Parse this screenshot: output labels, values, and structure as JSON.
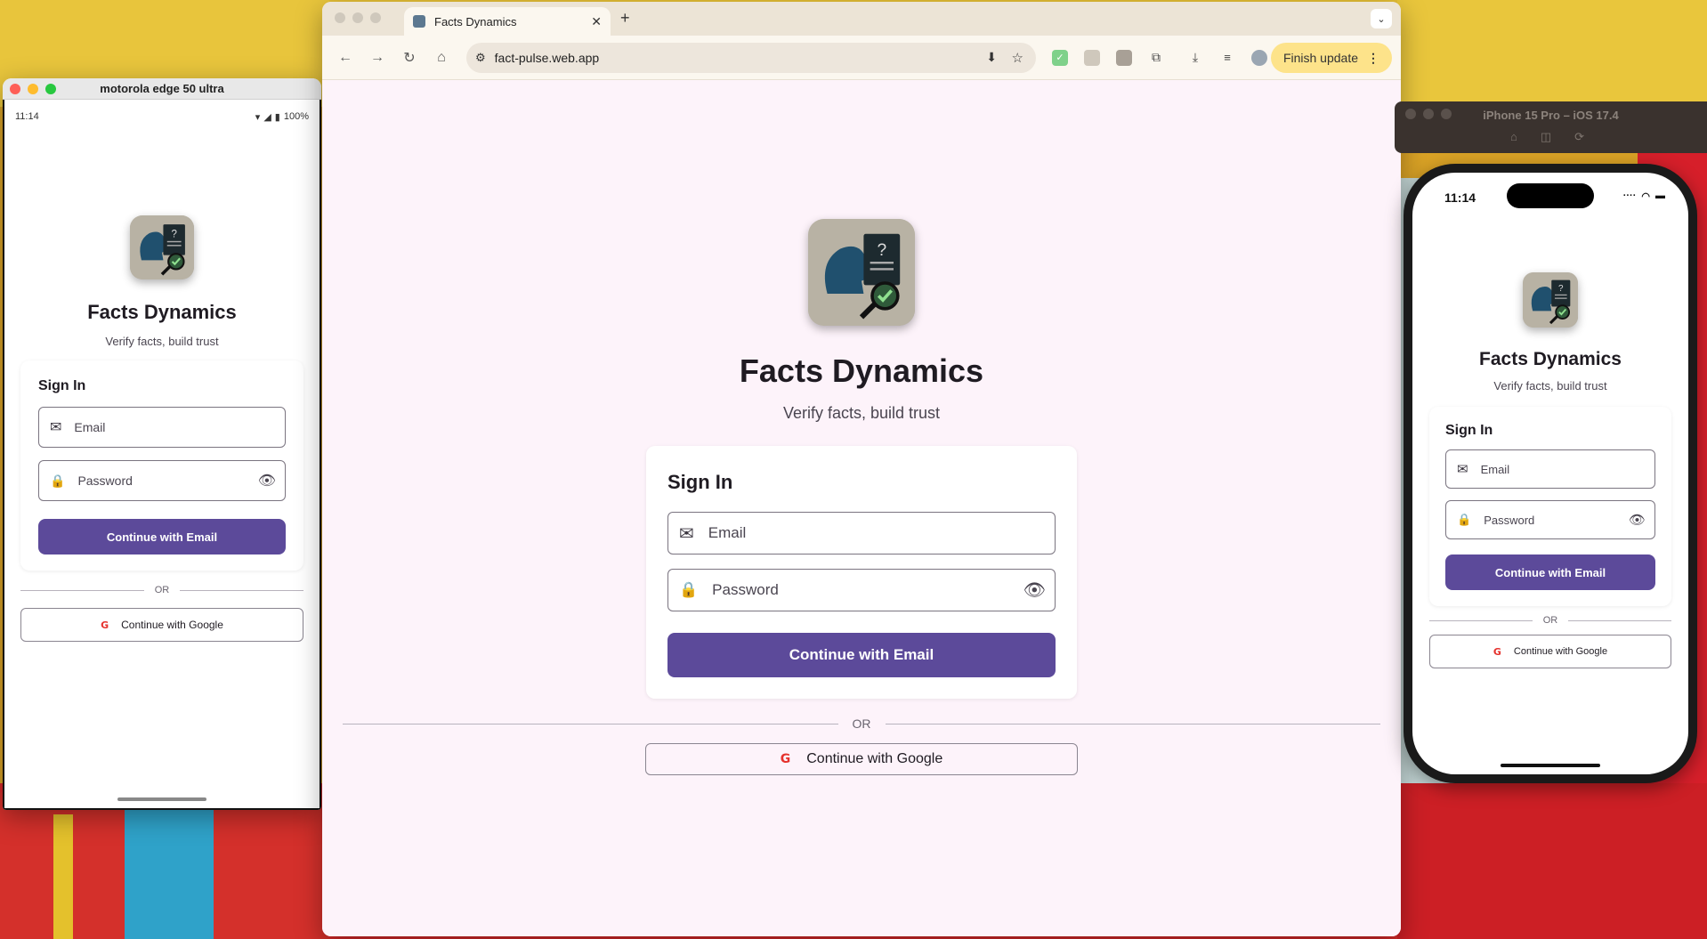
{
  "app": {
    "title": "Facts Dynamics",
    "subtitle": "Verify facts, build trust",
    "sign_in_title": "Sign In",
    "email_placeholder": "Email",
    "password_placeholder": "Password",
    "email_button": "Continue with Email",
    "or_label": "OR",
    "google_button": "Continue with Google",
    "google_mark": "G",
    "logo_question": "?"
  },
  "android": {
    "window_title": "motorola edge 50 ultra",
    "time": "11:14",
    "battery": "100%"
  },
  "browser": {
    "tab_title": "Facts Dynamics",
    "url": "fact-pulse.web.app",
    "finish_update": "Finish update"
  },
  "ios": {
    "window_title": "iPhone 15 Pro – iOS 17.4",
    "time": "11:14"
  },
  "colors": {
    "primary": "#5c4a9a",
    "page_bg": "#fdf3fa",
    "google_red": "#e5322d"
  }
}
